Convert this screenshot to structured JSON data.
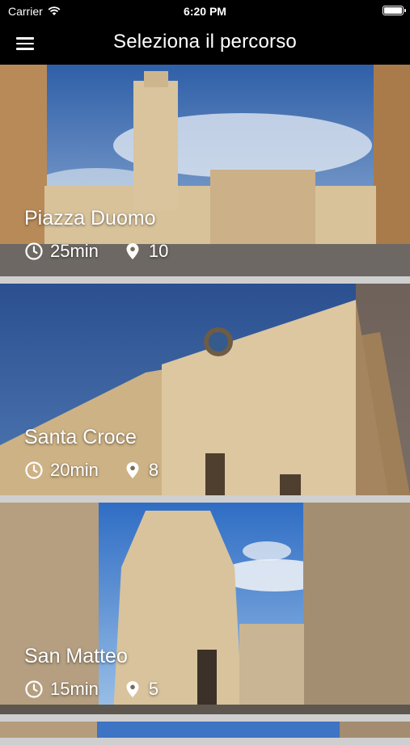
{
  "status_bar": {
    "carrier": "Carrier",
    "time": "6:20 PM"
  },
  "nav": {
    "title": "Seleziona il percorso",
    "menu_icon": "hamburger-menu-icon"
  },
  "routes": [
    {
      "name": "Piazza Duomo",
      "duration": "25min",
      "stops": "10"
    },
    {
      "name": "Santa Croce",
      "duration": "20min",
      "stops": "8"
    },
    {
      "name": "San Matteo",
      "duration": "15min",
      "stops": "5"
    }
  ],
  "colors": {
    "bar": "#000000",
    "separator": "#cfcfcf",
    "sky": "#3f6fb3",
    "stone": "#cfb48a"
  }
}
